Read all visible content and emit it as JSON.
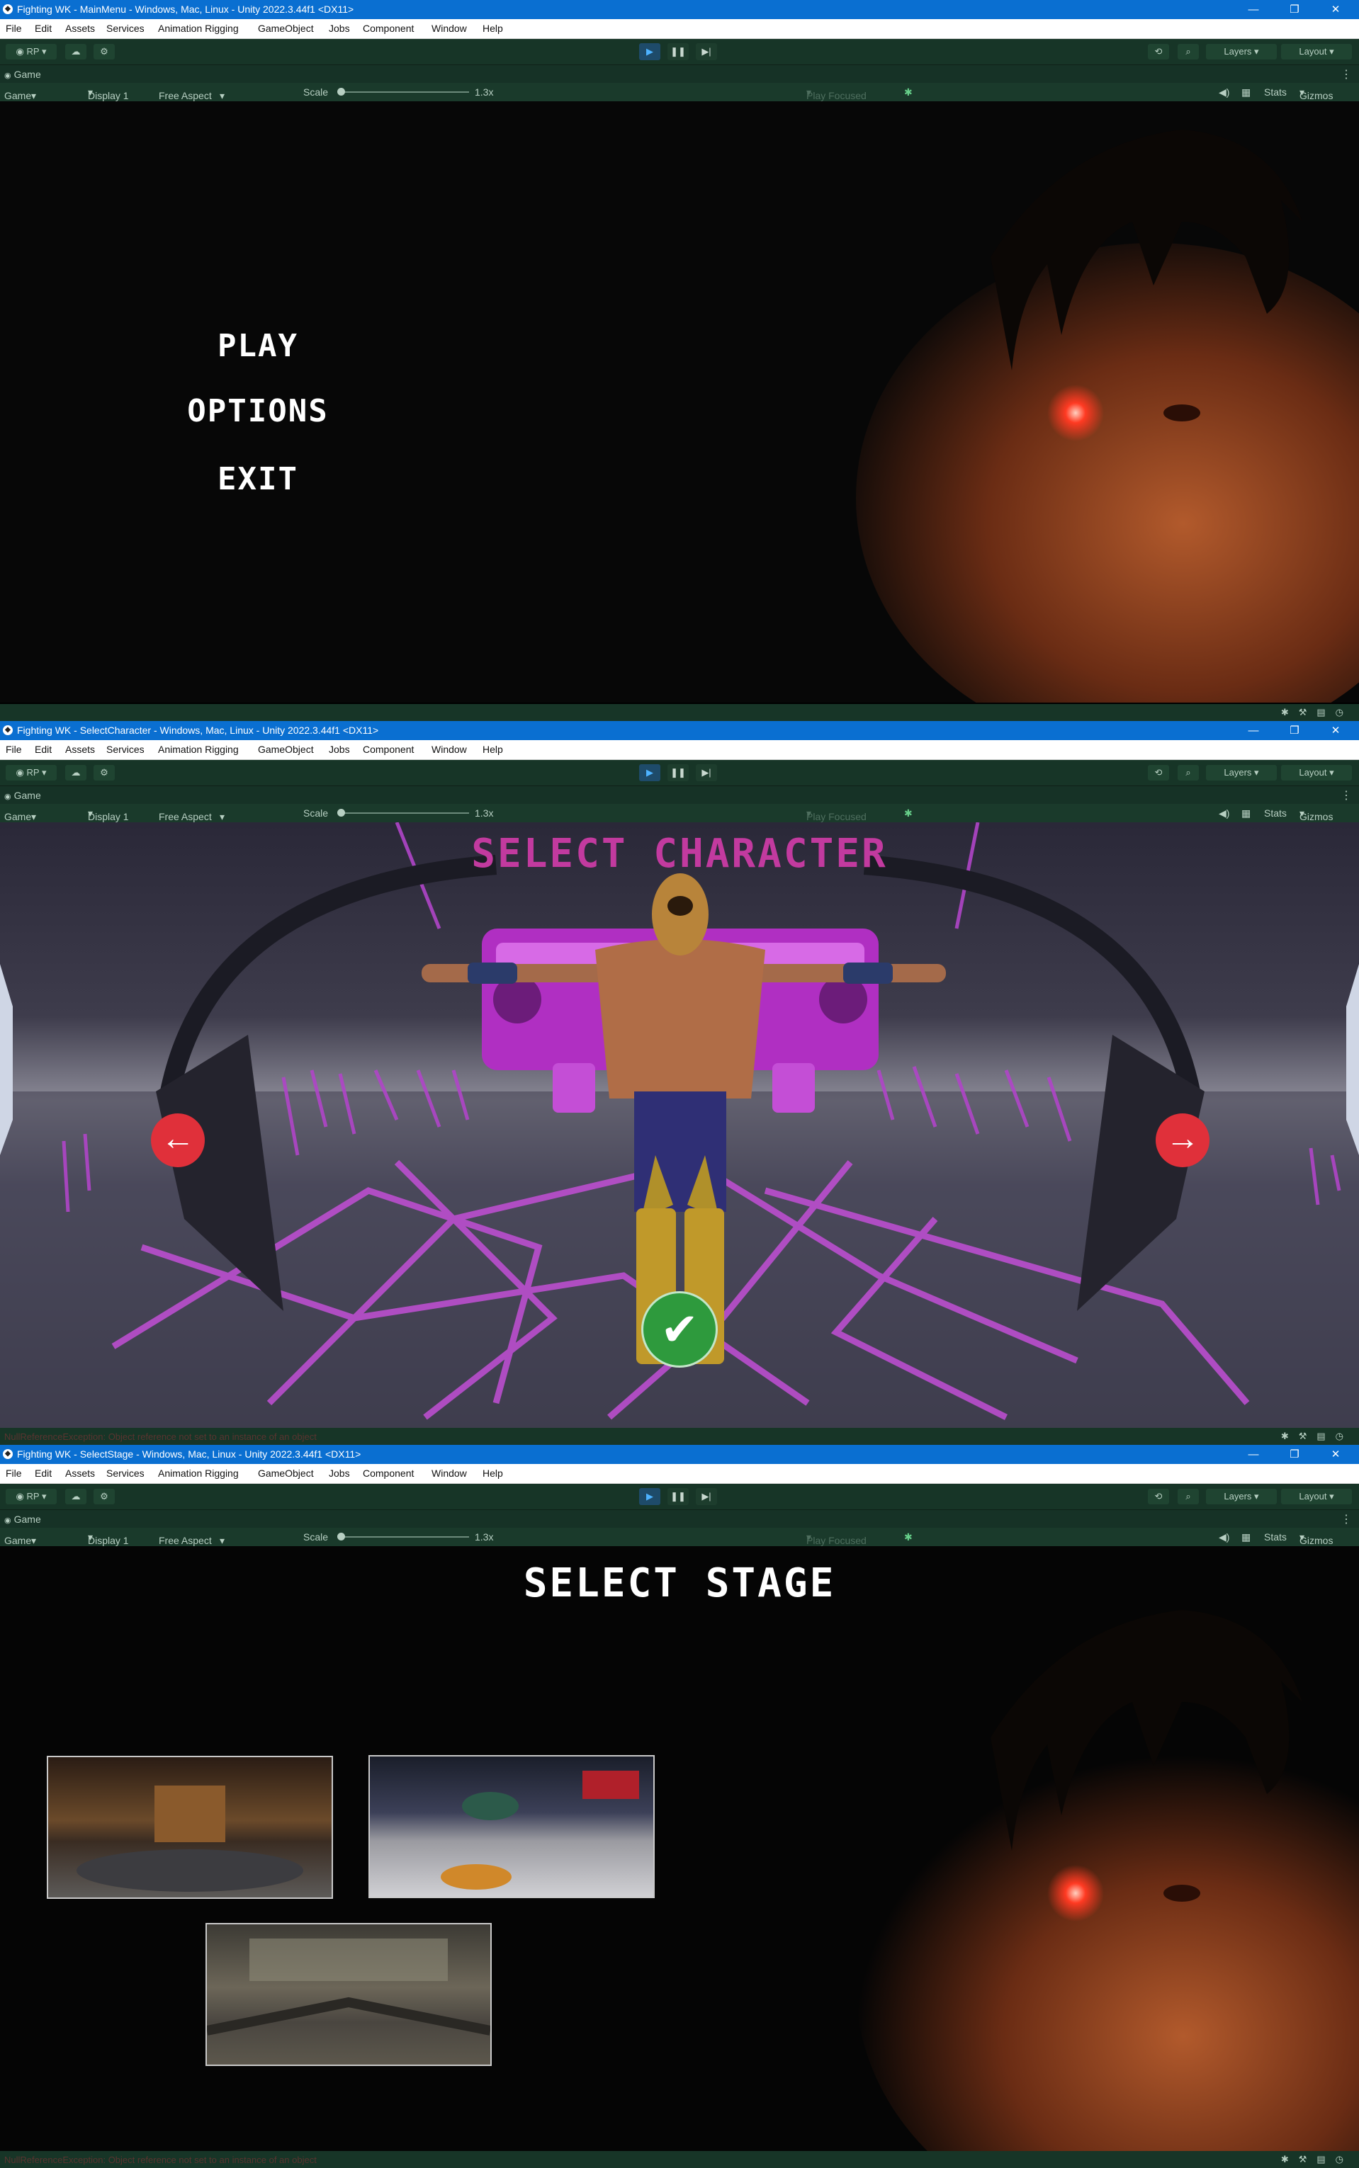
{
  "colors": {
    "titlebar": "#0a6fd1",
    "toolbar": "#173527",
    "select_character_title": "#c23a9f",
    "arrow": "#e0303a",
    "confirm": "#2e9a3d"
  },
  "menu_bar": {
    "items": [
      "File",
      "Edit",
      "Assets",
      "Services",
      "Animation Rigging",
      "GameObject",
      "Jobs",
      "Component",
      "Window",
      "Help"
    ]
  },
  "toolbar": {
    "rp_label": "RP",
    "layers_label": "Layers",
    "layout_label": "Layout",
    "icons": [
      "account-icon",
      "cloud-icon",
      "settings-icon",
      "play-icon",
      "pause-icon",
      "step-icon",
      "history-icon",
      "search-icon"
    ]
  },
  "game_bar": {
    "tab_label": "Game"
  },
  "game_controls": {
    "view_select": "Game",
    "display_select": "Display 1",
    "aspect_select": "Free Aspect",
    "scale_label": "Scale",
    "scale_value": "1.3x",
    "play_mode": "Play Focused",
    "stats_label": "Stats",
    "gizmos_label": "Gizmos"
  },
  "windows": [
    {
      "title": "Fighting WK - MainMenu - Windows, Mac, Linux - Unity 2022.3.44f1 <DX11>",
      "scene": {
        "menu_items": [
          "PLAY",
          "OPTIONS",
          "EXIT"
        ]
      },
      "status": {
        "message": ""
      }
    },
    {
      "title": "Fighting WK - SelectCharacter - Windows, Mac, Linux - Unity 2022.3.44f1 <DX11>",
      "scene": {
        "title": "SELECT CHARACTER"
      },
      "status": {
        "message": "NullReferenceException: Object reference not set to an instance of an object"
      }
    },
    {
      "title": "Fighting WK - SelectStage - Windows, Mac, Linux - Unity 2022.3.44f1 <DX11>",
      "scene": {
        "title": "SELECT STAGE",
        "stage_thumbnails": 3
      },
      "status": {
        "message": "NullReferenceException: Object reference not set to an instance of an object"
      }
    }
  ]
}
